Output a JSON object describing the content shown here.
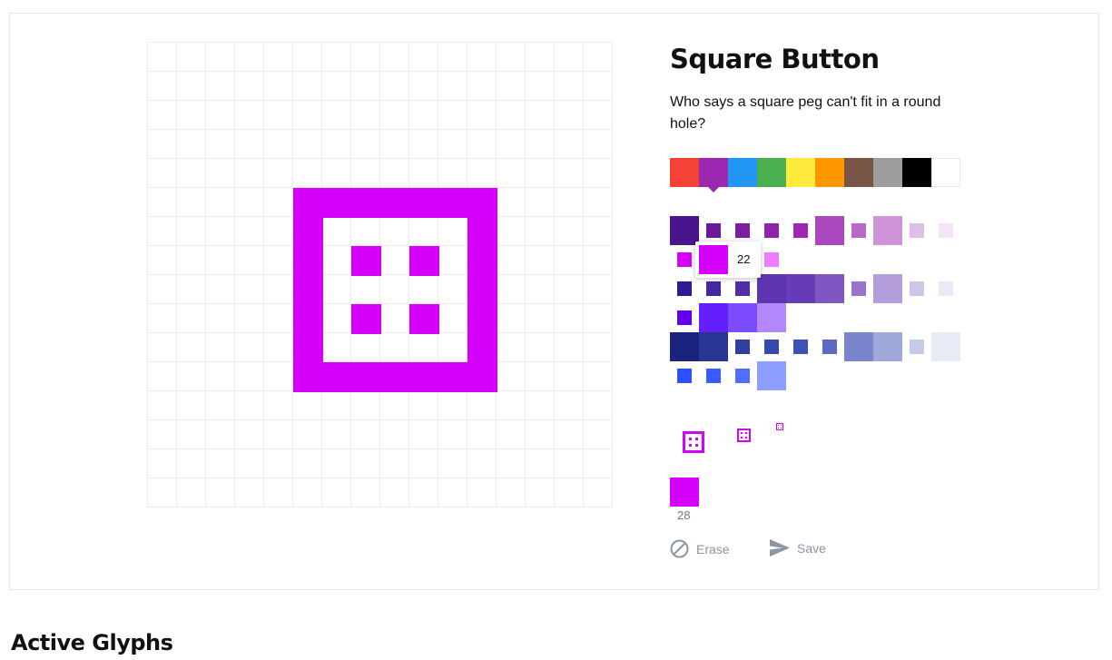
{
  "glyph": {
    "title": "Square Button",
    "description": "Who says a square peg can't fit in a round hole?",
    "color": "#d500f9"
  },
  "palette": {
    "colors": [
      "#f44336",
      "#9c27b0",
      "#2196f3",
      "#4caf50",
      "#ffeb3b",
      "#ff9800",
      "#795548",
      "#9e9e9e",
      "#000000",
      "#ffffff"
    ],
    "selected_index": 1
  },
  "shades": {
    "selected_value": "22"
  },
  "size": {
    "value": "28"
  },
  "actions": {
    "erase_label": "Erase",
    "save_label": "Save"
  },
  "sections": {
    "active_glyphs_title": "Active Glyphs"
  }
}
